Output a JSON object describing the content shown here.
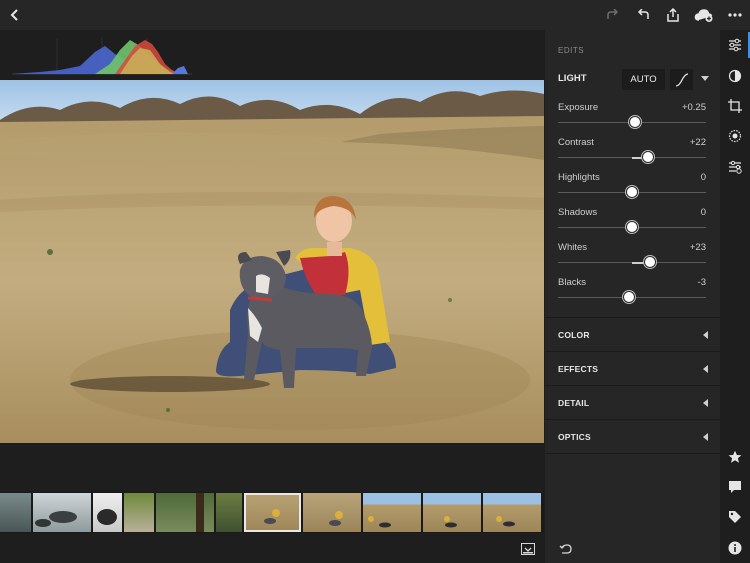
{
  "toolbar": {
    "back_icon": "chevron-left-icon",
    "redo_icon": "redo-icon",
    "undo_icon": "undo-icon",
    "share_icon": "share-icon",
    "cloud_icon": "cloud-add-icon",
    "more_icon": "more-icon"
  },
  "edits": {
    "title": "EDITS",
    "light": {
      "label": "LIGHT",
      "auto_label": "AUTO",
      "sliders": [
        {
          "name": "Exposure",
          "value": "+0.25",
          "position": 0.52
        },
        {
          "name": "Contrast",
          "value": "+22",
          "position": 0.61
        },
        {
          "name": "Highlights",
          "value": "0",
          "position": 0.5
        },
        {
          "name": "Shadows",
          "value": "0",
          "position": 0.5
        },
        {
          "name": "Whites",
          "value": "+23",
          "position": 0.62
        },
        {
          "name": "Blacks",
          "value": "-3",
          "position": 0.48
        }
      ]
    },
    "sections": [
      {
        "label": "COLOR"
      },
      {
        "label": "EFFECTS"
      },
      {
        "label": "DETAIL"
      },
      {
        "label": "OPTICS"
      }
    ]
  },
  "tools": [
    "edit-sliders-icon",
    "presets-icon",
    "crop-icon",
    "selective-icon",
    "healing-icon",
    "star-icon",
    "comment-icon",
    "tag-icon",
    "info-icon"
  ],
  "colors": {
    "accent": "#3d8ff0",
    "panel": "#262626",
    "background": "#1e1e1e"
  }
}
